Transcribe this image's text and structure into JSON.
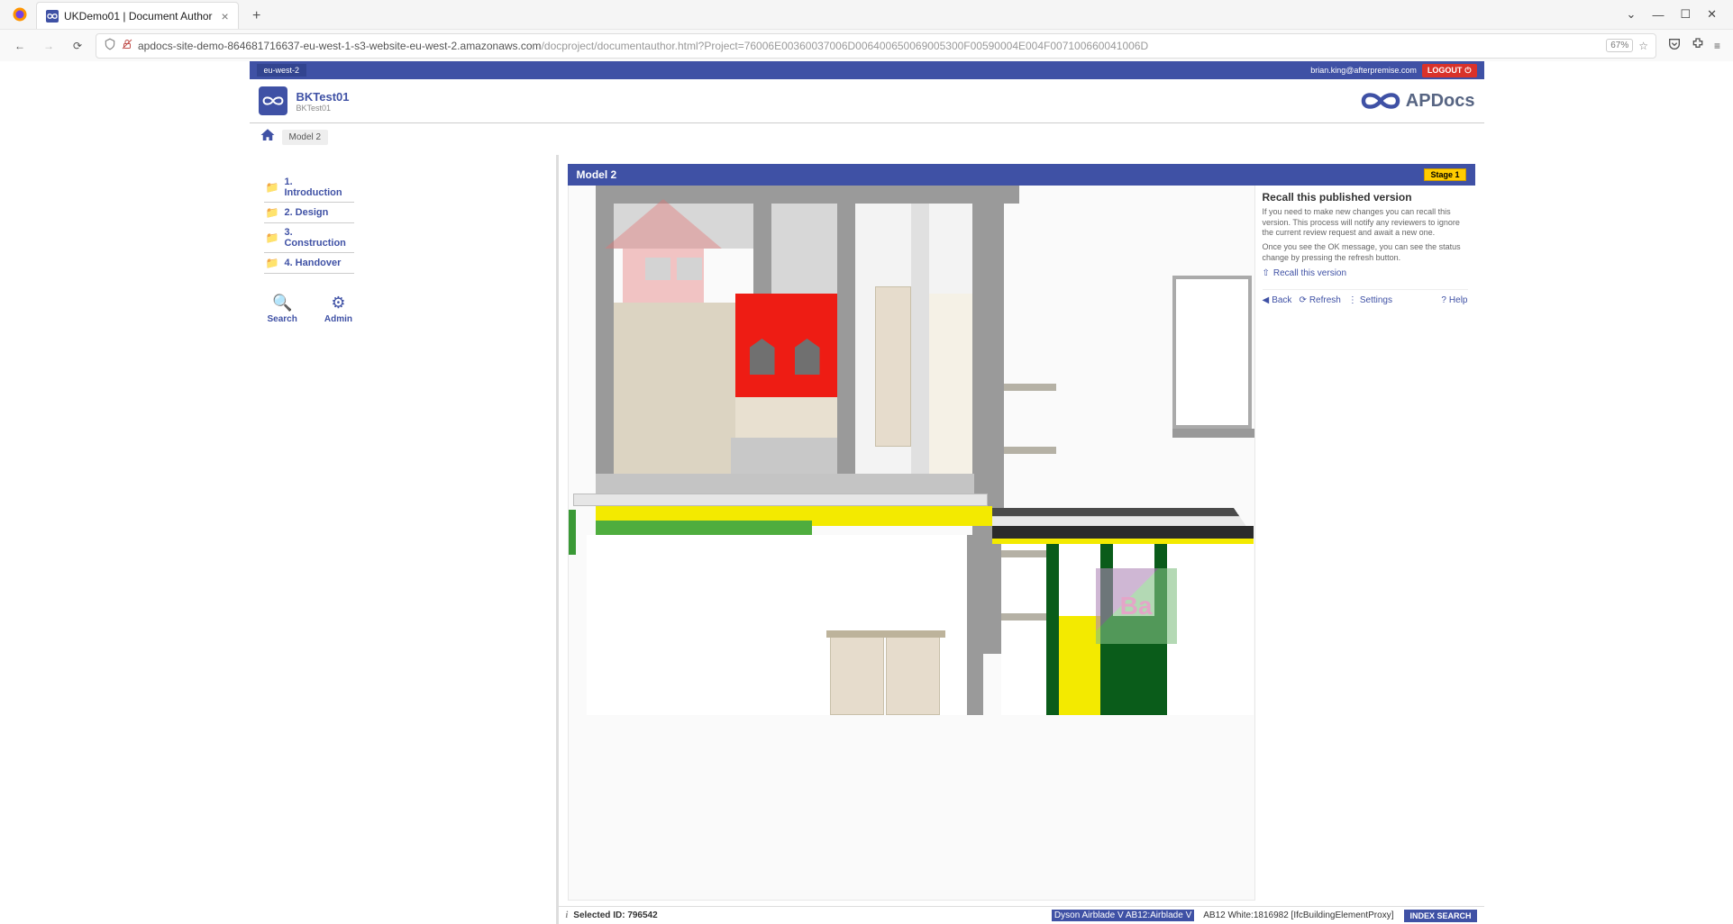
{
  "browser": {
    "tab_title": "UKDemo01 | Document Author",
    "url_host": "apdocs-site-demo-864681716637-eu-west-1-s3-website-eu-west-2.amazonaws.com",
    "url_path_dim1": "/docproject/",
    "url_path_main": "documentauthor.html?Project=76006E00360037006D006400650069005300F00590004E004F007100660041006D",
    "zoom": "67%"
  },
  "ribbon": {
    "region": "eu-west-2",
    "user_email": "brian.king@afterpremise.com",
    "logout": "LOGOUT"
  },
  "header": {
    "title": "BKTest01",
    "subtitle": "BKTest01",
    "brand": "APDocs"
  },
  "breadcrumb": {
    "current": "Model 2"
  },
  "nav": {
    "items": [
      {
        "label": "1. Introduction"
      },
      {
        "label": "2. Design"
      },
      {
        "label": "3. Construction"
      },
      {
        "label": "4. Handover"
      }
    ],
    "search": "Search",
    "admin": "Admin"
  },
  "content": {
    "title": "Model 2",
    "stage": "Stage 1"
  },
  "side_panel": {
    "heading": "Recall this published version",
    "p1": "If you need to make new changes you can recall this version. This process will notify any reviewers to ignore the current review request and await a new one.",
    "p2": "Once you see the OK message, you can see the status change by pressing the refresh button.",
    "recall": "Recall this version",
    "back": "Back",
    "refresh": "Refresh",
    "settings": "Settings",
    "help": "Help"
  },
  "status": {
    "selected_label": "Selected ID:",
    "selected_id": "796542",
    "highlighted": "Dyson Airblade V AB12:Airblade V",
    "rest": "AB12 White:1816982 [IfcBuildingElementProxy]",
    "index_search": "INDEX SEARCH"
  }
}
